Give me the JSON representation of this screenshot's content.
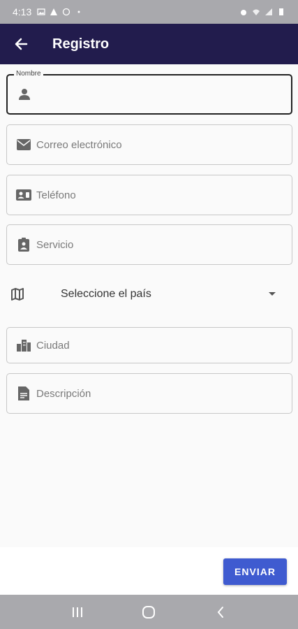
{
  "status_bar": {
    "time": "4:13",
    "left_icons": [
      "image-icon",
      "warning-icon",
      "whatsapp-icon",
      "dot-icon"
    ],
    "right_icons": [
      "alarm-icon",
      "wifi-icon",
      "signal-icon",
      "battery-icon"
    ]
  },
  "app_bar": {
    "title": "Registro",
    "back_icon": "arrow-back-icon",
    "background": "#221c4d"
  },
  "form": {
    "name": {
      "label": "Nombre",
      "value": "",
      "icon": "person-icon"
    },
    "email": {
      "placeholder": "Correo electrónico",
      "icon": "mail-icon"
    },
    "phone": {
      "placeholder": "Teléfono",
      "icon": "contact-phone-icon"
    },
    "service": {
      "placeholder": "Servicio",
      "icon": "badge-icon"
    },
    "country": {
      "selected": "Seleccione el país",
      "icon": "map-icon"
    },
    "city": {
      "placeholder": "Ciudad",
      "icon": "city-icon"
    },
    "description": {
      "placeholder": "Descripción",
      "icon": "document-icon"
    }
  },
  "actions": {
    "send_label": "ENVIAR",
    "send_color": "#3f5bd0"
  },
  "nav_bar": {
    "buttons": [
      "recents-icon",
      "home-icon",
      "back-icon"
    ]
  }
}
